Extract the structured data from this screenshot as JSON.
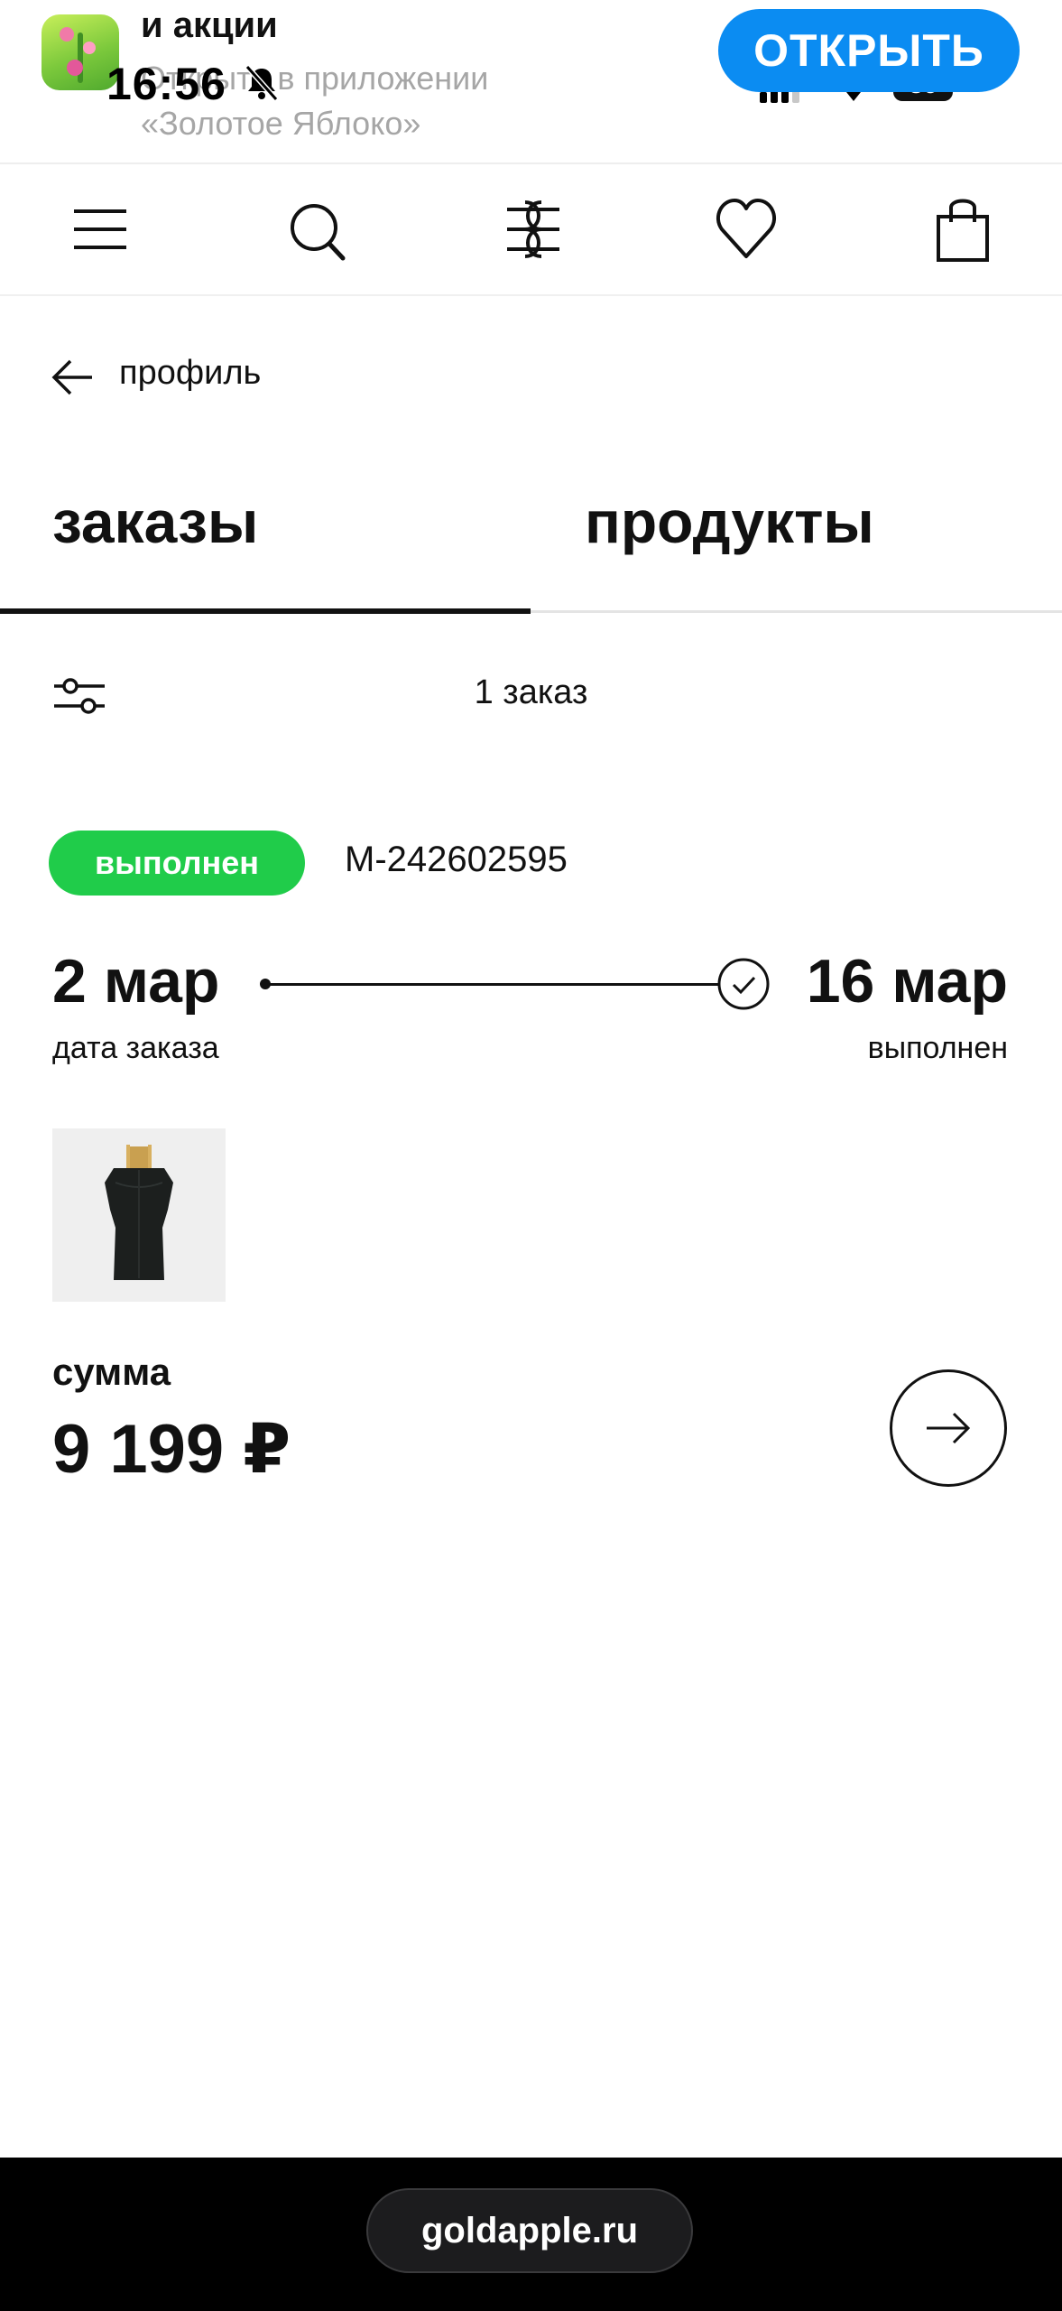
{
  "colors": {
    "accent_blue": "#0b8cf2",
    "status_green": "#20cc4a",
    "text": "#111111",
    "muted": "#a6a6a6",
    "bottom_bar": "#000000"
  },
  "status_bar": {
    "time": "16:56",
    "battery": "86",
    "icons": [
      "bell-slash-icon",
      "signal-icon",
      "wifi-icon",
      "battery-icon"
    ]
  },
  "app_banner": {
    "title": "и акции",
    "subtitle_line1": "Открыть в приложении",
    "subtitle_line2": "«Золотое Яблоко»",
    "open_button": "ОТКРЫТЬ",
    "icon": "golden-apple-app-icon"
  },
  "site_header": {
    "icons": [
      "menu-icon",
      "search-icon",
      "brand-logo-icon",
      "heart-icon",
      "bag-icon"
    ]
  },
  "breadcrumb": {
    "back_label": "профиль",
    "icon": "arrow-left-icon"
  },
  "tabs": [
    {
      "label": "заказы",
      "active": true
    },
    {
      "label": "продукты",
      "active": false
    }
  ],
  "filter_row": {
    "icon": "filter-sliders-icon",
    "count_text": "1 заказ"
  },
  "order": {
    "status": "выполнен",
    "number": "M-242602595",
    "order_date": "2 мар",
    "order_date_caption": "дата заказа",
    "done_date": "16 мар",
    "done_date_caption": "выполнен",
    "product_image": "perfume-bottle-image",
    "sum_label": "сумма",
    "sum_value": "9 199 ₽",
    "details_button_icon": "arrow-right-icon"
  },
  "browser": {
    "url": "goldapple.ru"
  }
}
